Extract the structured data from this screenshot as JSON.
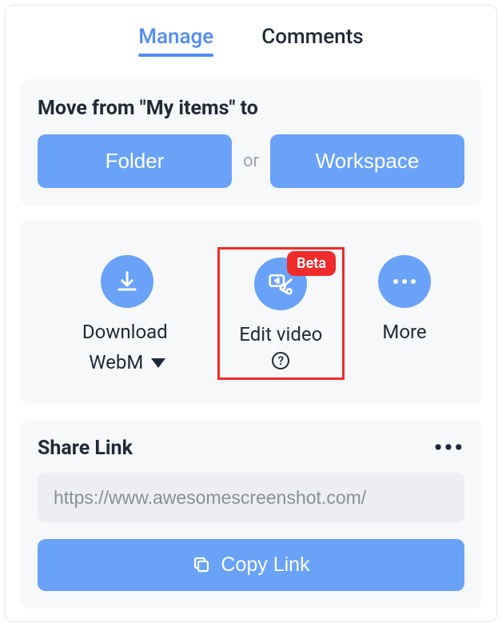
{
  "tabs": {
    "manage": "Manage",
    "comments": "Comments"
  },
  "move": {
    "title": "Move from \"My items\" to",
    "folder": "Folder",
    "or": "or",
    "workspace": "Workspace"
  },
  "actions": {
    "download_line1": "Download",
    "download_line2": "WebM",
    "edit_video": "Edit video",
    "beta": "Beta",
    "more": "More"
  },
  "share": {
    "title": "Share Link",
    "url": "https://www.awesomescreenshot.com/",
    "copy": "Copy Link"
  }
}
